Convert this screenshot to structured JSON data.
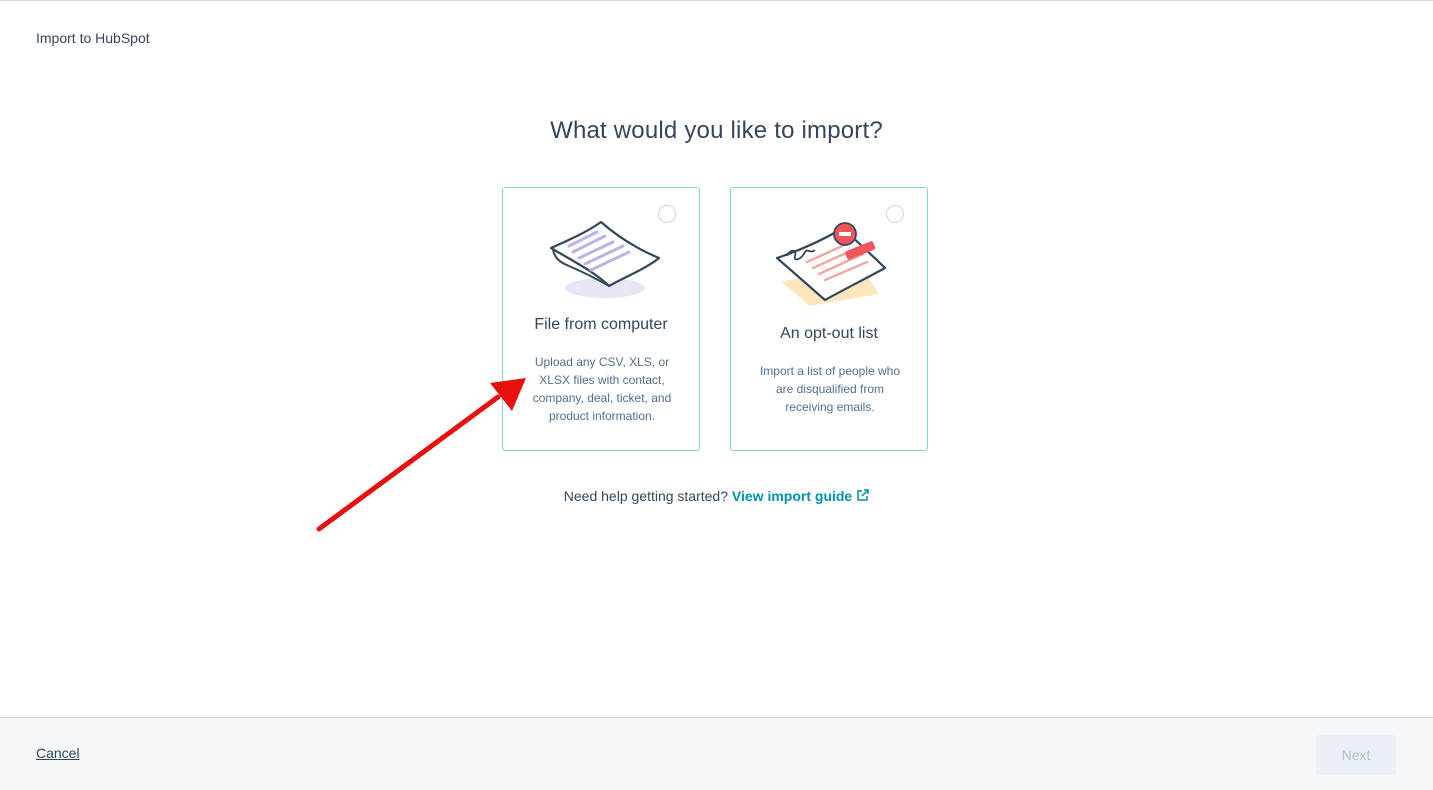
{
  "header": {
    "title": "Import to HubSpot"
  },
  "main": {
    "heading": "What would you like to import?",
    "options": [
      {
        "title": "File from computer",
        "description": "Upload any CSV, XLS, or XLSX files with contact, company, deal, ticket, and product information.",
        "icon": "file-document-illustration",
        "selected": false
      },
      {
        "title": "An opt-out list",
        "description": "Import a list of people who are disqualified from receiving emails.",
        "icon": "opt-out-document-illustration",
        "selected": false
      }
    ],
    "help": {
      "text": "Need help getting started?",
      "link_label": "View import guide",
      "link_icon": "external-link-icon"
    }
  },
  "footer": {
    "cancel_label": "Cancel",
    "next_label": "Next",
    "next_enabled": false
  },
  "colors": {
    "card_border": "#7fd1de",
    "link": "#0091ae",
    "annotation_arrow": "#e8100f",
    "text": "#33475b"
  }
}
